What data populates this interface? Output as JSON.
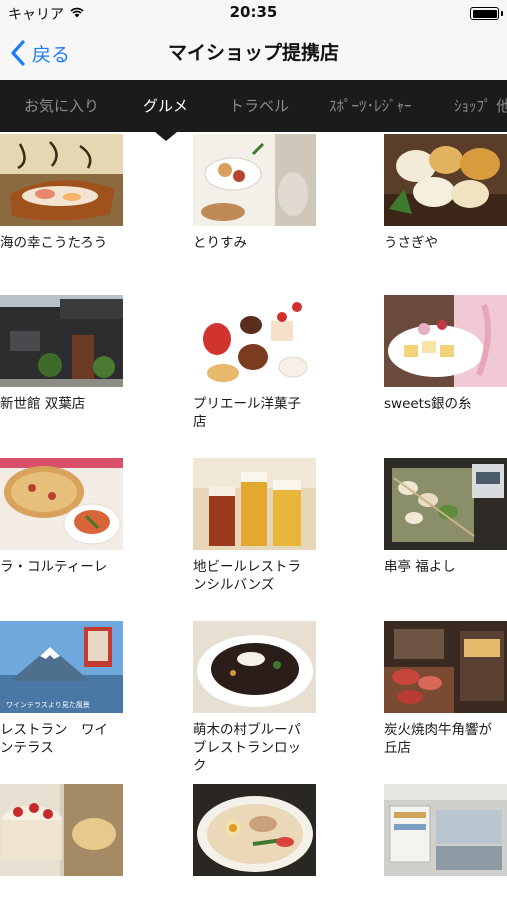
{
  "status_bar": {
    "carrier": "キャリア",
    "time": "20:35"
  },
  "nav": {
    "back_label": "戻る",
    "title": "マイショップ提携店"
  },
  "tabs": [
    {
      "label": "お気に入り",
      "active": false
    },
    {
      "label": "グルメ",
      "active": true
    },
    {
      "label": "トラベル",
      "active": false
    },
    {
      "label": "ｽﾎﾟｰﾂ･ﾚｼﾞｬｰ",
      "active": false
    },
    {
      "label": "ｼｮｯﾌﾟ 他",
      "active": false
    }
  ],
  "shops": [
    {
      "name": "海の幸こうたろう",
      "image": "seafood-platter-photo"
    },
    {
      "name": "とりすみ",
      "image": "chicken-dishes-photo"
    },
    {
      "name": "うさぎや",
      "image": "japanese-sweets-photo"
    },
    {
      "name": "新世館 双葉店",
      "image": "restaurant-building-photo"
    },
    {
      "name": "プリエール洋菓子店",
      "image": "cakes-display-photo"
    },
    {
      "name": "sweets銀の糸",
      "image": "pastry-plate-photo"
    },
    {
      "name": "ラ・コルティーレ",
      "image": "pizza-pasta-photo"
    },
    {
      "name": "地ビールレストランシルバンズ",
      "image": "craft-beer-photo"
    },
    {
      "name": "串亭 福よし",
      "image": "yakitori-skewers-photo"
    },
    {
      "name": "レストラン　ワインテラス",
      "image": "mount-fuji-terrace-photo",
      "caption": "ワインテラスより見た風景"
    },
    {
      "name": "萌木の村ブルーパブレストランロック",
      "image": "curry-rice-photo"
    },
    {
      "name": "炭火焼肉牛角響が丘店",
      "image": "yakiniku-restaurant-photo"
    },
    {
      "name": "",
      "image": "cake-photo"
    },
    {
      "name": "",
      "image": "ramen-bowl-photo"
    },
    {
      "name": "",
      "image": "shop-interior-photo"
    }
  ]
}
